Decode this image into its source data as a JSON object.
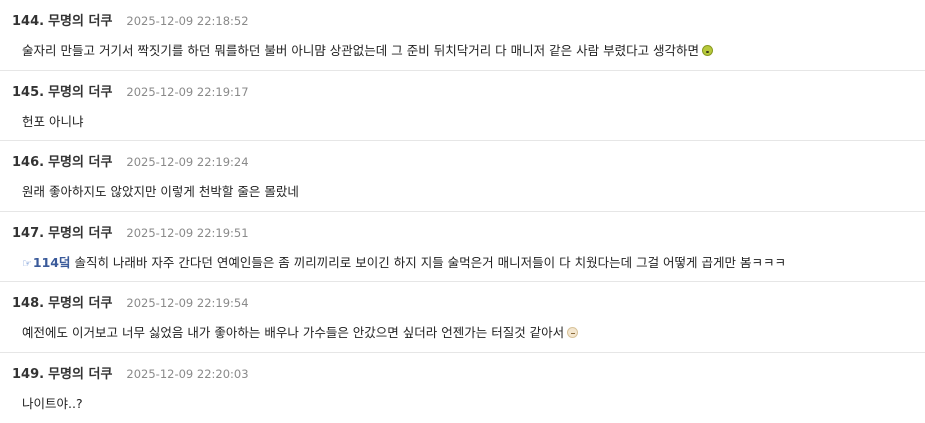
{
  "comments": [
    {
      "num": "144.",
      "author": "무명의 더쿠",
      "time": "2025-12-09 22:18:52",
      "body": "술자리 만들고 거기서 짝짓기를 하던 뭐를하던 불버 아니먐 상관없는데 그 준비 뒤치닥거리 다 매니저 같은 사람 부렸다고 생각하면",
      "emoji": "sick-face-icon"
    },
    {
      "num": "145.",
      "author": "무명의 더쿠",
      "time": "2025-12-09 22:19:17",
      "body": "헌포 아니냐"
    },
    {
      "num": "146.",
      "author": "무명의 더쿠",
      "time": "2025-12-09 22:19:24",
      "body": "원래 좋아하지도 않았지만 이렇게 천박할 줄은 몰랐네"
    },
    {
      "num": "147.",
      "author": "무명의 더쿠",
      "time": "2025-12-09 22:19:51",
      "reply_icon": "☞",
      "reply_ref": "114덬",
      "body": " 솔직히 나래바 자주 간다던 연예인들은 좀 끼리끼리로 보이긴 하지 지들 술먹은거 매니저들이 다 치웠다는데 그걸 어떻게 곱게만 봄ㅋㅋㅋ"
    },
    {
      "num": "148.",
      "author": "무명의 더쿠",
      "time": "2025-12-09 22:19:54",
      "body": "예전에도 이거보고 너무 싫었음 내가 좋아하는 배우나 가수들은 안갔으면 싶더라 언젠가는 터질것 같아서",
      "emoji": "neutral-face-icon"
    },
    {
      "num": "149.",
      "author": "무명의 더쿠",
      "time": "2025-12-09 22:20:03",
      "body": "나이트야..?"
    }
  ]
}
